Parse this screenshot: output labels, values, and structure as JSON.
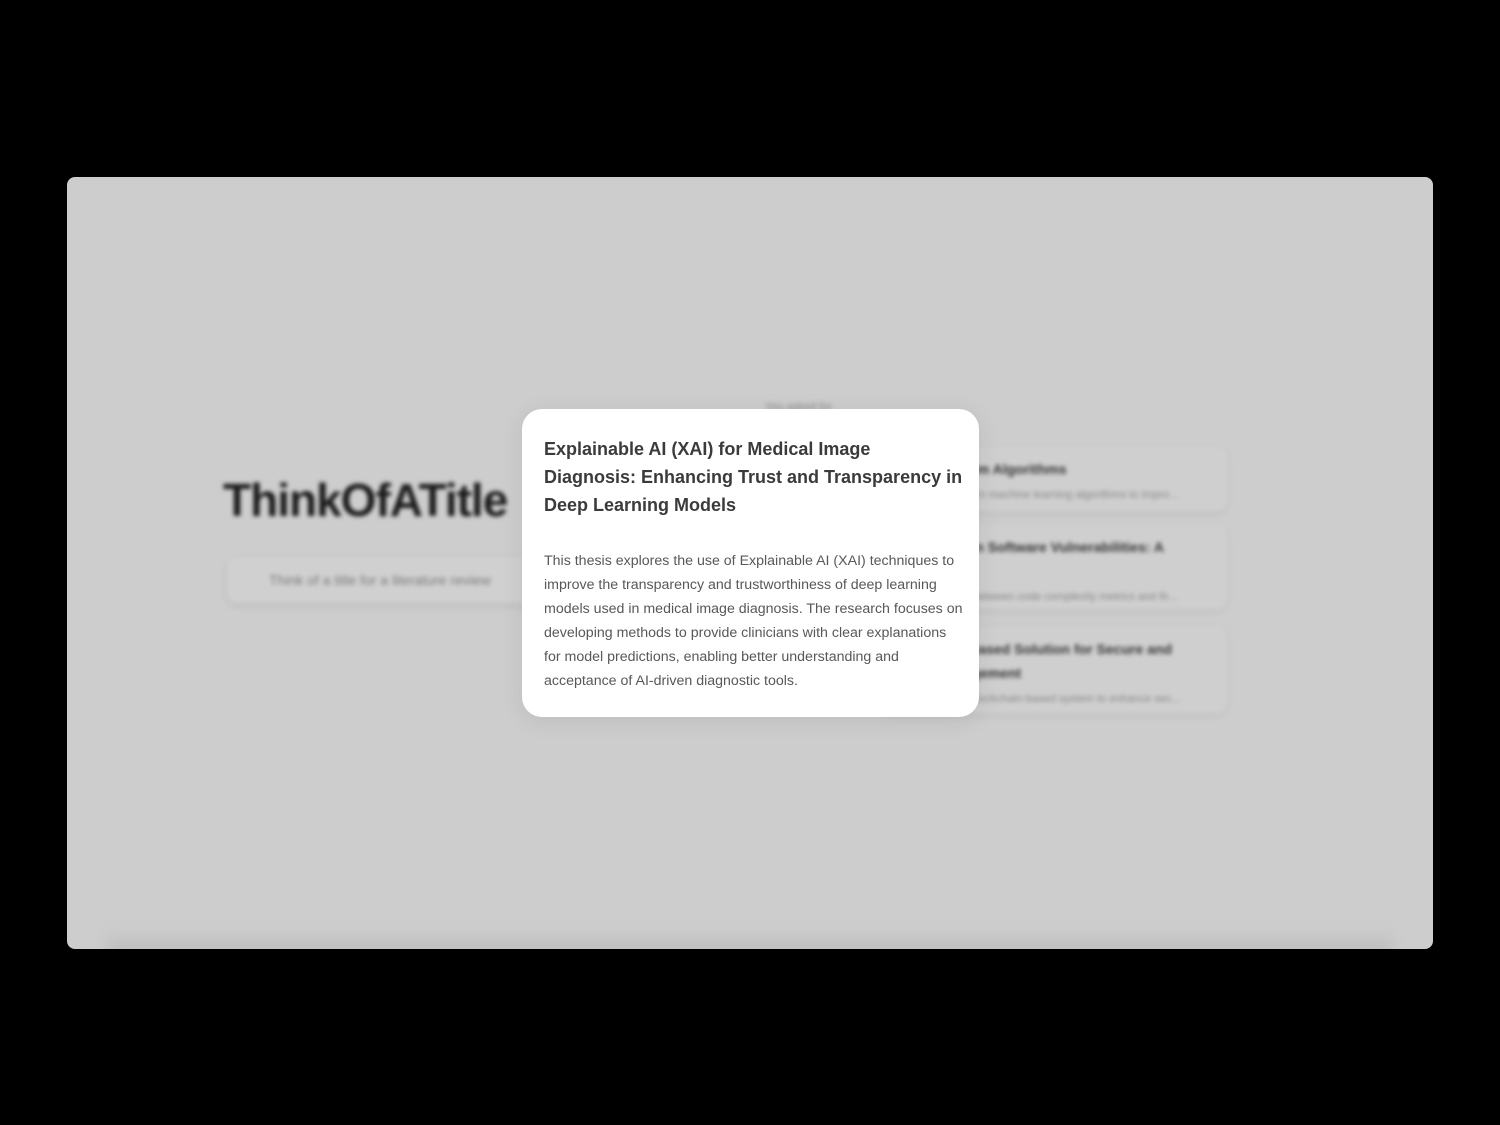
{
  "app": {
    "logo": "ThinkOfATitle"
  },
  "search": {
    "placeholder": "Think of a title for a literature review"
  },
  "results": {
    "header": "You asked for",
    "items": [
      {
        "title": "ntum Algorithms",
        "snippet": "antum machine learning algorithms to impro..."
      },
      {
        "title": "y on Software Vulnerabilities: A",
        "snippet": "hip between code complexity metrics and th..."
      },
      {
        "title": "n-Based Solution for Secure and",
        "title_line2": "nagement",
        "snippet": "f a blockchain-based system to enhance sec..."
      }
    ]
  },
  "modal": {
    "title": "Explainable AI (XAI) for Medical Image Diagnosis: Enhancing Trust and Transparency in Deep Learning Models",
    "description": "This thesis explores the use of Explainable AI (XAI) techniques to improve the transparency and trustworthiness of deep learning models used in medical image diagnosis. The research focuses on developing methods to provide clinicians with clear explanations for model predictions, enabling better understanding and acceptance of AI-driven diagnostic tools."
  },
  "colors": {
    "backdrop": "#000000",
    "overlay": "#cdcdcd",
    "modal_bg": "#ffffff",
    "title_text": "#3b3b3b",
    "body_text": "#585858"
  }
}
